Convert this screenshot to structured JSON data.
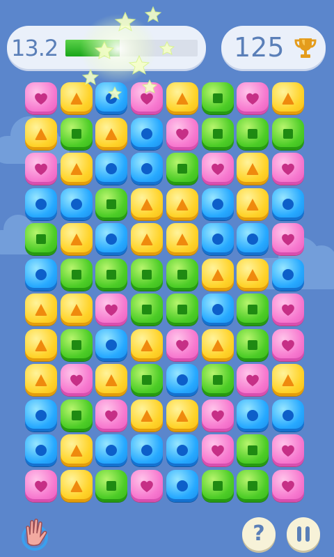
{
  "hud": {
    "timer_value": "13.2",
    "time_remaining_fraction": 0.41,
    "score_value": "125",
    "trophy_icon": "trophy-icon"
  },
  "colors": {
    "background": "#5b86cc",
    "pink": "#f779cf",
    "yellow": "#ffd32a",
    "blue": "#27a9ff",
    "green": "#4dcd27"
  },
  "board": {
    "columns": 8,
    "rows": 12,
    "grid": [
      [
        "P",
        "Y",
        "B",
        "P",
        "Y",
        "G",
        "P",
        "Y"
      ],
      [
        "Y",
        "G",
        "Y",
        "B",
        "P",
        "G",
        "G",
        "G"
      ],
      [
        "P",
        "Y",
        "B",
        "B",
        "G",
        "P",
        "Y",
        "P"
      ],
      [
        "B",
        "B",
        "G",
        "Y",
        "Y",
        "B",
        "Y",
        "B"
      ],
      [
        "G",
        "Y",
        "B",
        "Y",
        "Y",
        "B",
        "B",
        "P"
      ],
      [
        "B",
        "G",
        "G",
        "G",
        "G",
        "Y",
        "Y",
        "B"
      ],
      [
        "Y",
        "Y",
        "P",
        "G",
        "G",
        "B",
        "G",
        "P"
      ],
      [
        "Y",
        "G",
        "B",
        "Y",
        "P",
        "Y",
        "G",
        "P"
      ],
      [
        "Y",
        "P",
        "Y",
        "G",
        "B",
        "G",
        "P",
        "Y"
      ],
      [
        "B",
        "G",
        "P",
        "Y",
        "Y",
        "P",
        "B",
        "B"
      ],
      [
        "B",
        "Y",
        "B",
        "B",
        "B",
        "P",
        "G",
        "P"
      ],
      [
        "P",
        "Y",
        "G",
        "P",
        "B",
        "G",
        "G",
        "P"
      ]
    ],
    "legend": {
      "P": "pink-heart",
      "Y": "yellow-triangle",
      "B": "blue-circle",
      "G": "green-square"
    }
  },
  "controls": {
    "help_label": "?",
    "pause_icon": "pause-icon",
    "hand_icon": "hand-icon"
  }
}
